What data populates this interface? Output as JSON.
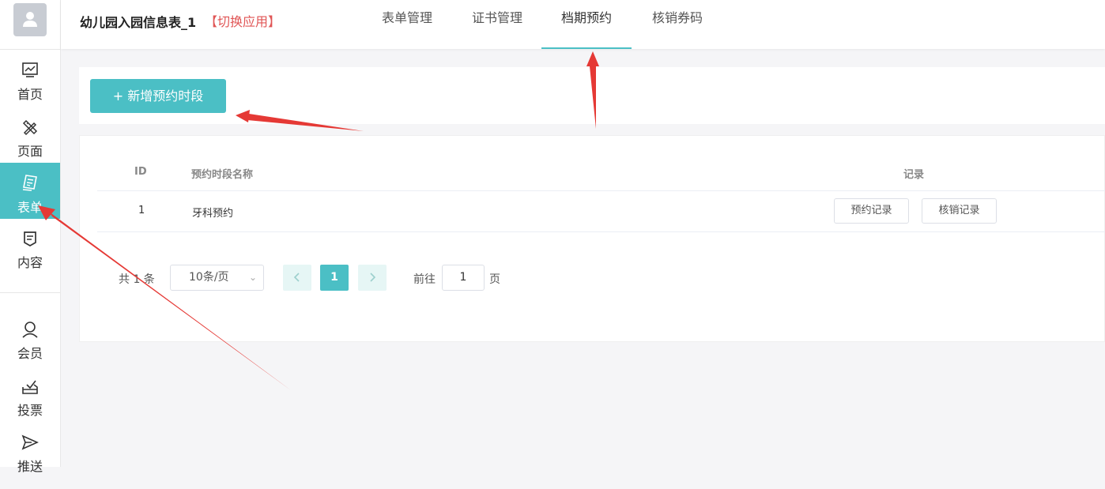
{
  "sidebar": {
    "items": [
      {
        "label": "首页",
        "icon": "chart-icon"
      },
      {
        "label": "页面",
        "icon": "design-icon"
      },
      {
        "label": "表单",
        "icon": "form-icon",
        "active": true
      },
      {
        "label": "内容",
        "icon": "content-icon"
      },
      {
        "label": "会员",
        "icon": "user-icon"
      },
      {
        "label": "投票",
        "icon": "vote-icon"
      },
      {
        "label": "推送",
        "icon": "send-icon"
      }
    ]
  },
  "header": {
    "title": "幼儿园入园信息表_1",
    "switch_label": "【切换应用】",
    "tabs": [
      {
        "label": "表单管理"
      },
      {
        "label": "证书管理"
      },
      {
        "label": "档期预约",
        "active": true
      },
      {
        "label": "核销券码"
      }
    ]
  },
  "toolbar": {
    "add_label": "+ 新增预约时段"
  },
  "table": {
    "columns": {
      "id": "ID",
      "name": "预约时段名称",
      "records": "记录"
    },
    "rows": [
      {
        "id": "1",
        "name": "牙科预约",
        "btn_booking": "预约记录",
        "btn_redeem": "核销记录"
      }
    ]
  },
  "pagination": {
    "total_label": "共 1 条",
    "page_size": "10条/页",
    "current_page": "1",
    "goto_label": "前往",
    "goto_value": "1",
    "page_unit": "页",
    "prev_icon": "chevron-left-icon",
    "next_icon": "chevron-right-icon"
  },
  "colors": {
    "accent": "#4bbfc5",
    "annotation": "#e53935",
    "switch": "#e05555"
  }
}
